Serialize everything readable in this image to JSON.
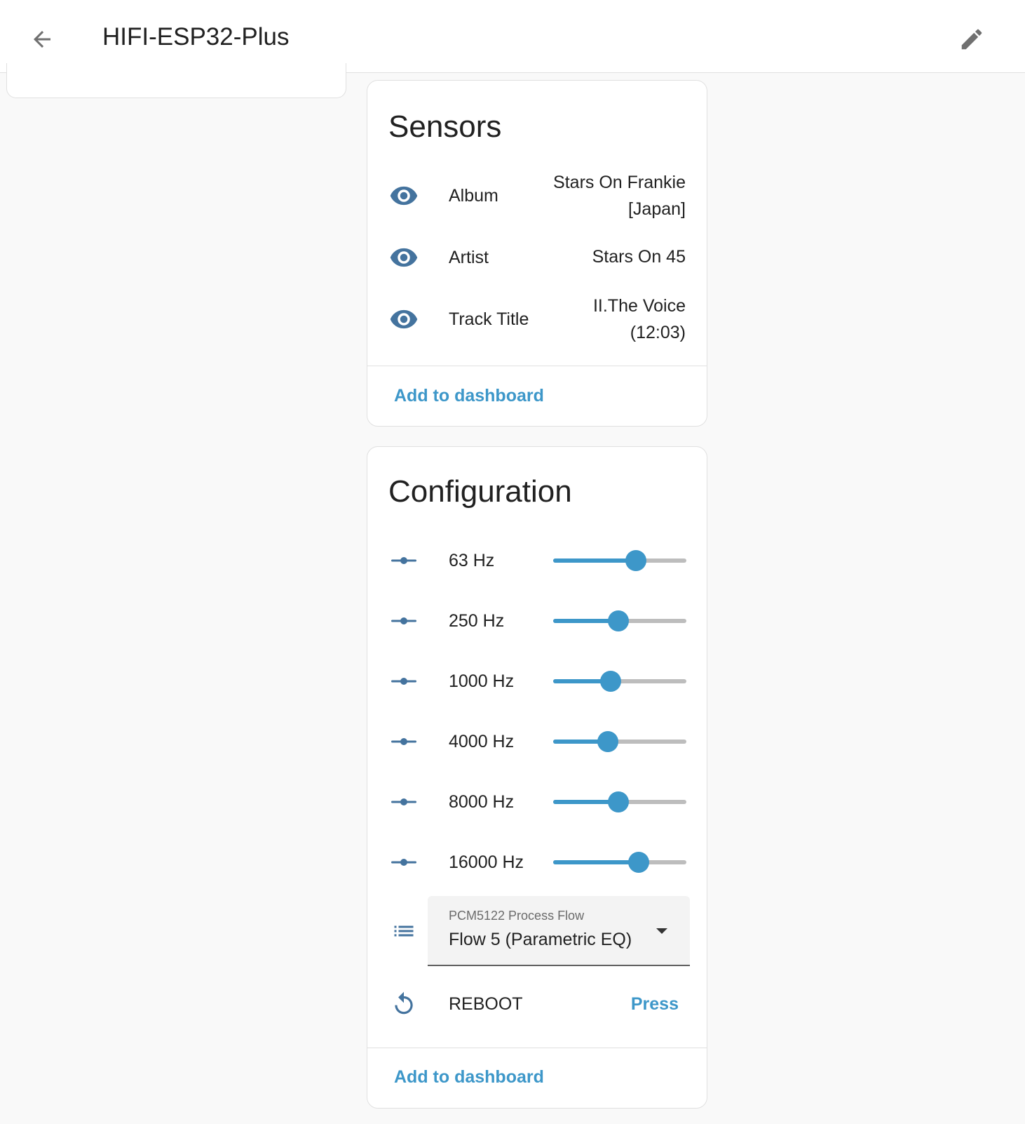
{
  "header": {
    "title": "HIFI-ESP32-Plus",
    "back_icon": "arrow-left-icon",
    "edit_icon": "pencil-icon"
  },
  "sensors": {
    "title": "Sensors",
    "items": [
      {
        "label": "Album",
        "value_line1": "Stars On Frankie",
        "value_line2": "[Japan]",
        "icon": "eye-icon"
      },
      {
        "label": "Artist",
        "value_line1": "Stars On 45",
        "value_line2": "",
        "icon": "eye-icon"
      },
      {
        "label": "Track Title",
        "value_line1": "II.The Voice",
        "value_line2": "(12:03)",
        "icon": "eye-icon"
      }
    ],
    "add_to_dashboard": "Add to dashboard"
  },
  "configuration": {
    "title": "Configuration",
    "sliders": [
      {
        "label": "63 Hz",
        "level": 0.62
      },
      {
        "label": "250 Hz",
        "level": 0.49
      },
      {
        "label": "1000 Hz",
        "level": 0.43
      },
      {
        "label": "4000 Hz",
        "level": 0.41
      },
      {
        "label": "8000 Hz",
        "level": 0.49
      },
      {
        "label": "16000 Hz",
        "level": 0.64
      }
    ],
    "select": {
      "label": "PCM5122 Process Flow",
      "value": "Flow 5 (Parametric EQ)",
      "icon": "list-icon"
    },
    "reboot": {
      "label": "REBOOT",
      "button": "Press",
      "icon": "restart-icon"
    },
    "add_to_dashboard": "Add to dashboard"
  },
  "colors": {
    "accent": "#3d97c9",
    "icon": "#44739e",
    "track": "#bdbdbd"
  }
}
